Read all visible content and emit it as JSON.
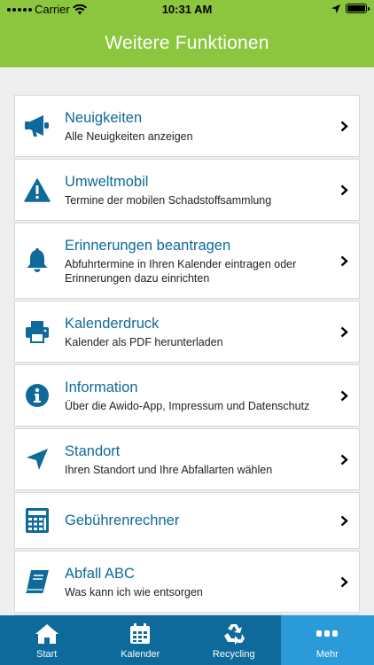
{
  "status_bar": {
    "carrier": "Carrier",
    "time": "10:31 AM"
  },
  "header": {
    "title": "Weitere Funktionen"
  },
  "items": [
    {
      "title": "Neuigkeiten",
      "subtitle": "Alle Neuigkeiten anzeigen",
      "icon": "megaphone-icon"
    },
    {
      "title": "Umweltmobil",
      "subtitle": "Termine der mobilen Schadstoffsammlung",
      "icon": "warning-icon"
    },
    {
      "title": "Erinnerungen beantragen",
      "subtitle": "Abfuhrtermine in Ihren Kalender eintragen oder Erinnerungen dazu einrichten",
      "icon": "bell-icon"
    },
    {
      "title": "Kalenderdruck",
      "subtitle": "Kalender als PDF herunterladen",
      "icon": "printer-icon"
    },
    {
      "title": "Information",
      "subtitle": "Über die Awido-App, Impressum und Datenschutz",
      "icon": "info-icon"
    },
    {
      "title": "Standort",
      "subtitle": "Ihren Standort und Ihre Abfallarten wählen",
      "icon": "location-arrow-icon"
    },
    {
      "title": "Gebührenrechner",
      "subtitle": "",
      "icon": "calculator-icon"
    },
    {
      "title": "Abfall ABC",
      "subtitle": "Was kann ich wie entsorgen",
      "icon": "book-icon"
    }
  ],
  "tabs": [
    {
      "label": "Start",
      "icon": "home-icon",
      "active": false
    },
    {
      "label": "Kalender",
      "icon": "calendar-icon",
      "active": false
    },
    {
      "label": "Recycling",
      "icon": "recycle-icon",
      "active": false
    },
    {
      "label": "Mehr",
      "icon": "more-icon",
      "active": true
    }
  ],
  "colors": {
    "header": "#8cc63f",
    "primary": "#0e6a9a",
    "tab_active": "#2a9ad8",
    "background": "#efefef"
  }
}
